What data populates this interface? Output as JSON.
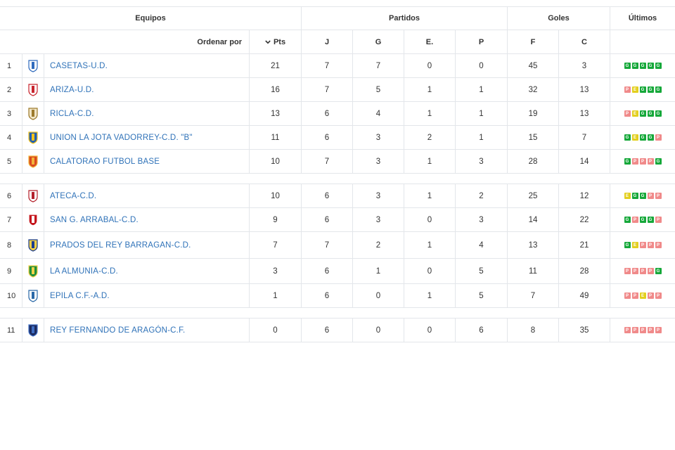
{
  "header": {
    "groups": {
      "teams": "Equipos",
      "matches": "Partidos",
      "goals": "Goles",
      "last": "Últimos"
    },
    "sort_label": "Ordenar por",
    "columns": {
      "pts": "Pts",
      "j": "J",
      "g": "G",
      "e": "E.",
      "p": "P",
      "f": "F",
      "c": "C"
    }
  },
  "colors": {
    "G": "#16a83a",
    "E": "#e3cf1f",
    "P": "#f08a8a",
    "link": "#2f72b8",
    "border": "#e3e6ea"
  },
  "standings": [
    {
      "pos": "1",
      "team": "CASETAS-U.D.",
      "crest": "casetas-crest-icon",
      "pts": "21",
      "j": "7",
      "g": "7",
      "e": "0",
      "p": "0",
      "f": "45",
      "c": "3",
      "form": [
        "G",
        "G",
        "G",
        "G",
        "G"
      ]
    },
    {
      "pos": "2",
      "team": "ARIZA-U.D.",
      "crest": "ariza-crest-icon",
      "pts": "16",
      "j": "7",
      "g": "5",
      "e": "1",
      "p": "1",
      "f": "32",
      "c": "13",
      "form": [
        "P",
        "E",
        "G",
        "G",
        "G"
      ]
    },
    {
      "pos": "3",
      "team": "RICLA-C.D.",
      "crest": "ricla-crest-icon",
      "pts": "13",
      "j": "6",
      "g": "4",
      "e": "1",
      "p": "1",
      "f": "19",
      "c": "13",
      "form": [
        "P",
        "E",
        "G",
        "G",
        "G"
      ]
    },
    {
      "pos": "4",
      "team": "UNION LA JOTA VADORREY-C.D. \"B\"",
      "crest": "union-la-jota-crest-icon",
      "pts": "11",
      "j": "6",
      "g": "3",
      "e": "2",
      "p": "1",
      "f": "15",
      "c": "7",
      "form": [
        "G",
        "E",
        "G",
        "G",
        "P"
      ]
    },
    {
      "pos": "5",
      "team": "CALATORAO FUTBOL BASE",
      "crest": "calatorao-crest-icon",
      "pts": "10",
      "j": "7",
      "g": "3",
      "e": "1",
      "p": "3",
      "f": "28",
      "c": "14",
      "form": [
        "G",
        "P",
        "P",
        "P",
        "G"
      ]
    },
    {
      "pos": "6",
      "team": "ATECA-C.D.",
      "crest": "ateca-crest-icon",
      "pts": "10",
      "j": "6",
      "g": "3",
      "e": "1",
      "p": "2",
      "f": "25",
      "c": "12",
      "form": [
        "E",
        "G",
        "G",
        "P",
        "P"
      ]
    },
    {
      "pos": "7",
      "team": "SAN G. ARRABAL-C.D.",
      "crest": "san-g-arrabal-crest-icon",
      "pts": "9",
      "j": "6",
      "g": "3",
      "e": "0",
      "p": "3",
      "f": "14",
      "c": "22",
      "form": [
        "G",
        "P",
        "G",
        "G",
        "P"
      ]
    },
    {
      "pos": "8",
      "team": "PRADOS DEL REY BARRAGAN-C.D.",
      "crest": "prados-del-rey-crest-icon",
      "pts": "7",
      "j": "7",
      "g": "2",
      "e": "1",
      "p": "4",
      "f": "13",
      "c": "21",
      "form": [
        "G",
        "E",
        "P",
        "P",
        "P"
      ]
    },
    {
      "pos": "9",
      "team": "LA ALMUNIA-C.D.",
      "crest": "la-almunia-crest-icon",
      "pts": "3",
      "j": "6",
      "g": "1",
      "e": "0",
      "p": "5",
      "f": "11",
      "c": "28",
      "form": [
        "P",
        "P",
        "P",
        "P",
        "G"
      ]
    },
    {
      "pos": "10",
      "team": "EPILA C.F.-A.D.",
      "crest": "epila-crest-icon",
      "pts": "1",
      "j": "6",
      "g": "0",
      "e": "1",
      "p": "5",
      "f": "7",
      "c": "49",
      "form": [
        "P",
        "P",
        "E",
        "P",
        "P"
      ]
    },
    {
      "pos": "11",
      "team": "REY FERNANDO DE ARAGÓN-C.F.",
      "crest": "rey-fernando-crest-icon",
      "pts": "0",
      "j": "6",
      "g": "0",
      "e": "0",
      "p": "6",
      "f": "8",
      "c": "35",
      "form": [
        "P",
        "P",
        "P",
        "P",
        "P"
      ]
    }
  ]
}
